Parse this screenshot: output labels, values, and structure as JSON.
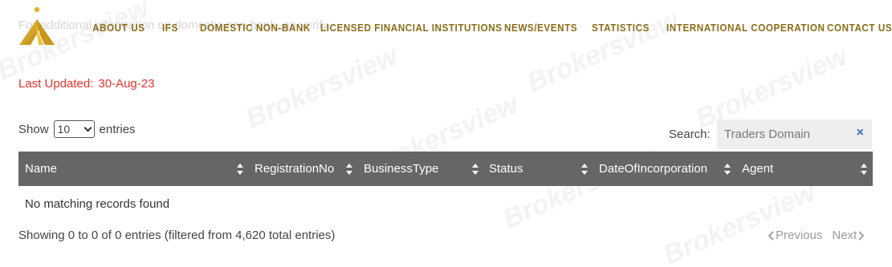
{
  "header": {
    "ghost_text": "For additional information on domestic non-bank, an verify",
    "nav": [
      "ABOUT US",
      "IFS",
      "DOMESTIC NON-BANK",
      "LICENSED FINANCIAL INSTITUTIONS",
      "NEWS/EVENTS",
      "STATISTICS",
      "INTERNATIONAL COOPERATION",
      "CONTACT US"
    ],
    "brand_color": "#8a6d1a"
  },
  "last_updated": {
    "label": "Last Updated:",
    "value": "30-Aug-23"
  },
  "length_control": {
    "prefix": "Show",
    "value": "10",
    "suffix": "entries"
  },
  "search": {
    "label": "Search:",
    "value": "Traders Domain",
    "clear": "×"
  },
  "table": {
    "columns": [
      "Name",
      "RegistrationNo",
      "BusinessType",
      "Status",
      "DateOfIncorporation",
      "Agent"
    ],
    "empty_message": "No matching records found"
  },
  "info_text": "Showing 0 to 0 of 0 entries (filtered from 4,620 total entries)",
  "pagination": {
    "previous": "Previous",
    "next": "Next"
  },
  "watermark": "Brokersview"
}
